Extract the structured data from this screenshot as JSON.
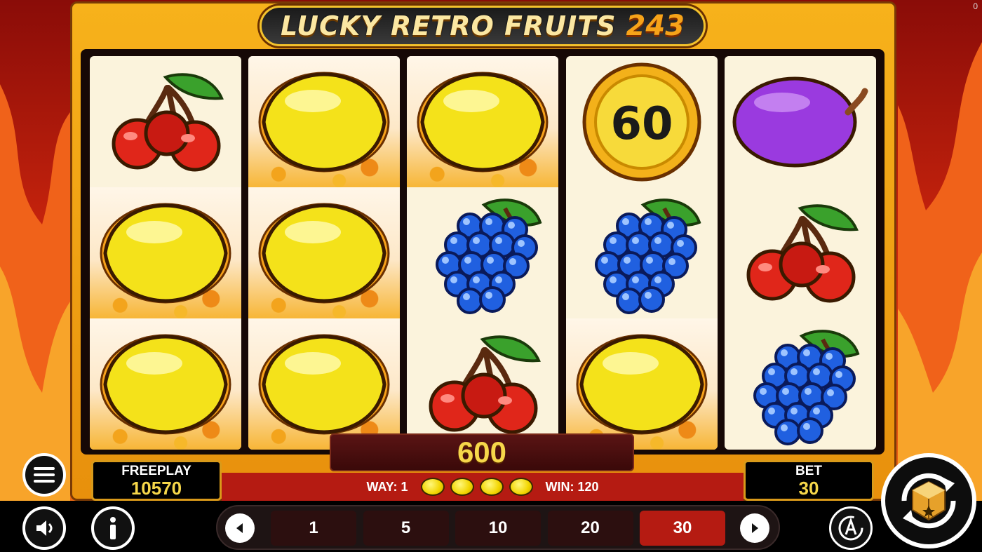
{
  "game": {
    "title": "LUCKY RETRO FRUITS",
    "title_number": "243",
    "corner_counter": "0"
  },
  "reels": [
    [
      "cherry",
      "lemon",
      "lemon"
    ],
    [
      "lemon",
      "lemon",
      "lemon"
    ],
    [
      "lemon",
      "grapes",
      "cherry"
    ],
    [
      "coin-60",
      "grapes",
      "lemon"
    ],
    [
      "plum",
      "cherry",
      "grapes"
    ]
  ],
  "winning_cells": [
    [
      0,
      1
    ],
    [
      0,
      2
    ],
    [
      1,
      0
    ],
    [
      1,
      1
    ],
    [
      1,
      2
    ],
    [
      2,
      0
    ],
    [
      3,
      2
    ]
  ],
  "coin_value": "60",
  "win": {
    "amount": "600",
    "way_label": "WAY: 1",
    "win_label": "WIN: 120",
    "way_symbols": [
      "lemon",
      "lemon",
      "lemon",
      "lemon"
    ]
  },
  "freeplay": {
    "label": "FREEPLAY",
    "value": "10570"
  },
  "bet": {
    "label": "BET",
    "value": "30"
  },
  "bet_options": [
    "1",
    "5",
    "10",
    "20",
    "30"
  ],
  "selected_bet": "30",
  "icons": {
    "menu": "hamburger-icon",
    "sound": "speaker-icon",
    "info": "info-icon",
    "prev": "arrow-left-icon",
    "next": "arrow-right-icon",
    "autoplay": "autoplay-icon",
    "spin": "spin-icon"
  },
  "colors": {
    "frame": "#f7b21b",
    "strip": "#b51b12",
    "win_text": "#f6d74a",
    "selected_bet": "#b51b12"
  }
}
